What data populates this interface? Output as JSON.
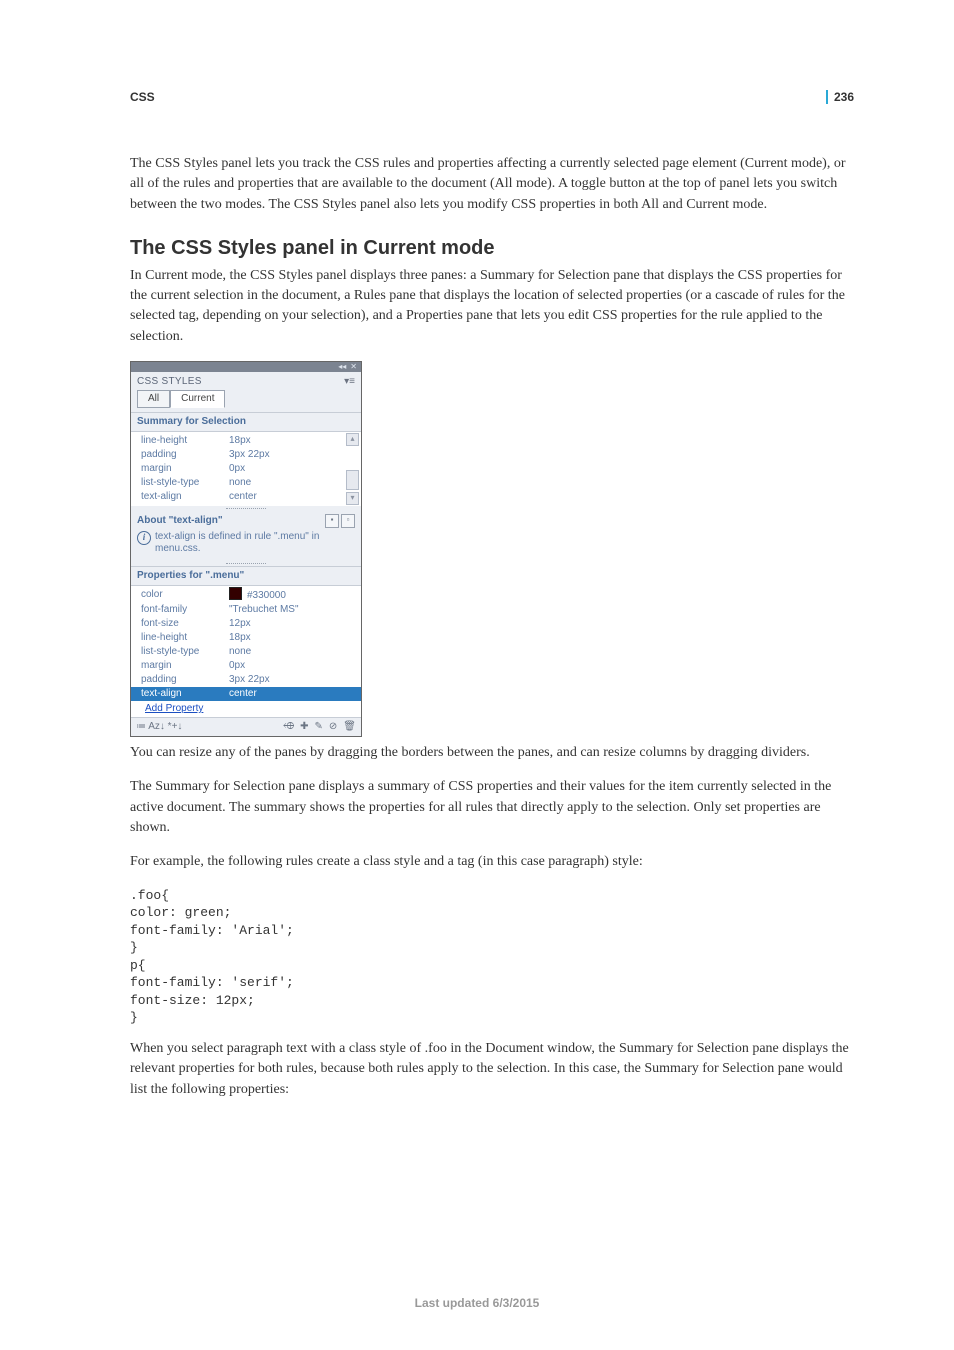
{
  "header": {
    "section": "CSS",
    "page_number": "236"
  },
  "para1": "The CSS Styles panel lets you track the CSS rules and properties affecting a currently selected page element (Current mode), or all of the rules and properties that are available to the document (All mode). A toggle button at the top of panel lets you switch between the two modes. The CSS Styles panel also lets you modify CSS properties in both All and Current mode.",
  "heading": "The CSS Styles panel in Current mode",
  "para2": "In Current mode, the CSS Styles panel displays three panes: a Summary for Selection pane that displays the CSS properties for the current selection in the document, a Rules pane that displays the location of selected properties (or a cascade of rules for the selected tag, depending on your selection), and a Properties pane that lets you edit CSS properties for the rule applied to the selection.",
  "panel": {
    "title": "CSS STYLES",
    "tabs": {
      "all": "All",
      "current": "Current"
    },
    "summary_header": "Summary for Selection",
    "summary_rows": [
      {
        "name": "line-height",
        "val": "18px"
      },
      {
        "name": "padding",
        "val": "3px 22px"
      },
      {
        "name": "margin",
        "val": "0px"
      },
      {
        "name": "list-style-type",
        "val": "none"
      },
      {
        "name": "text-align",
        "val": "center"
      }
    ],
    "about_header": "About \"text-align\"",
    "about_text": "text-align is defined in rule \".menu\" in menu.css.",
    "props_header": "Properties for \".menu\"",
    "prop_rows": [
      {
        "name": "color",
        "val": "#330000",
        "swatch": true
      },
      {
        "name": "font-family",
        "val": "\"Trebuchet MS\""
      },
      {
        "name": "font-size",
        "val": "12px"
      },
      {
        "name": "line-height",
        "val": "18px"
      },
      {
        "name": "list-style-type",
        "val": "none"
      },
      {
        "name": "margin",
        "val": "0px"
      },
      {
        "name": "padding",
        "val": "3px 22px"
      },
      {
        "name": "text-align",
        "val": "center",
        "selected": true
      }
    ],
    "add_property": "Add Property",
    "footer_left": "≔ Aᴢ↓ *+↓"
  },
  "para3": "You can resize any of the panes by dragging the borders between the panes, and can resize columns by dragging dividers.",
  "para4": "The Summary for Selection pane displays a summary of CSS properties and their values for the item currently selected in the active document. The summary shows the properties for all rules that directly apply to the selection. Only set properties are shown.",
  "para5": "For example, the following rules create a class style and a tag (in this case paragraph) style:",
  "code": ".foo{\ncolor: green;\nfont-family: 'Arial';\n}\np{\nfont-family: 'serif';\nfont-size: 12px;\n}",
  "para6": "When you select paragraph text with a class style of .foo in the Document window, the Summary for Selection pane displays the relevant properties for both rules, because both rules apply to the selection. In this case, the Summary for Selection pane would list the following properties:",
  "footer": "Last updated 6/3/2015"
}
